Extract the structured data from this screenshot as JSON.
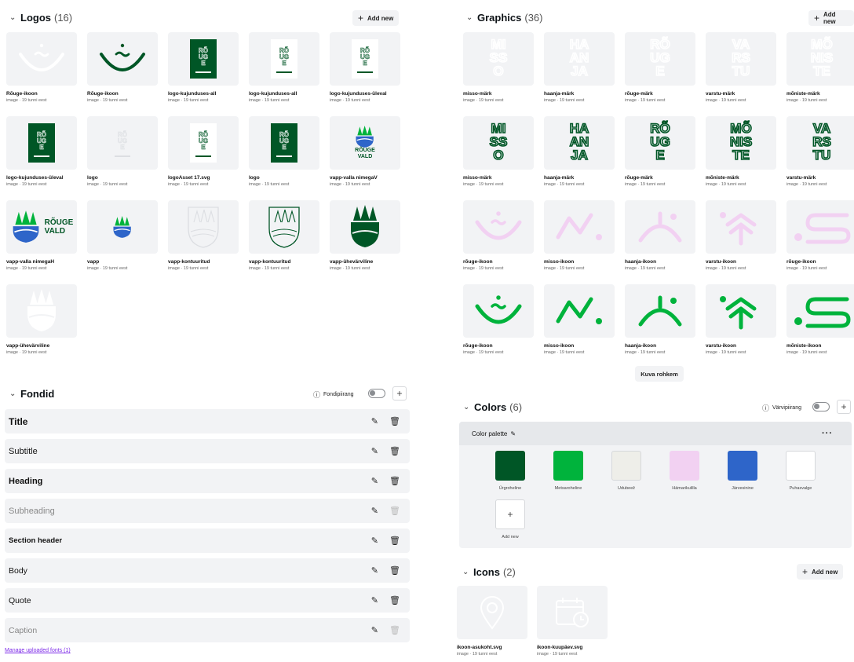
{
  "colors": {
    "dark_green": "#005626",
    "bright_green": "#00b33c",
    "pink": "#f2d1f2",
    "blue": "#2e65c9",
    "mist": "#eeeee9"
  },
  "logos": {
    "title": "Logos",
    "count": "(16)",
    "add_label": "Add new",
    "items": [
      {
        "name": "Rõuge-ikoon",
        "meta": "image · 19 tunni eest",
        "icon": "smile-symbol-white"
      },
      {
        "name": "Rõuge-ikoon",
        "meta": "image · 19 tunni eest",
        "icon": "smile-symbol-green"
      },
      {
        "name": "logo-kujunduses-all",
        "meta": "image · 19 tunni eest",
        "icon": "rouge-logo-green-box"
      },
      {
        "name": "logo-kujunduses-all",
        "meta": "image · 19 tunni eest",
        "icon": "rouge-logo-vald-white"
      },
      {
        "name": "logo-kujunduses-üleval",
        "meta": "image · 19 tunni eest",
        "icon": "rouge-logo-vald-white"
      },
      {
        "name": "logo-kujunduses-üleval",
        "meta": "image · 19 tunni eest",
        "icon": "rouge-logo-green-box"
      },
      {
        "name": "logo",
        "meta": "image · 19 tunni eest",
        "icon": "rouge-logo-faded"
      },
      {
        "name": "logoAsset 17.svg",
        "meta": "image · 19 tunni eest",
        "icon": "rouge-logo-vald-white"
      },
      {
        "name": "logo",
        "meta": "image · 19 tunni eest",
        "icon": "rouge-logo-green-box"
      },
      {
        "name": "vapp-valla nimegaV",
        "meta": "image · 19 tunni eest",
        "icon": "coat-of-arms-vertical"
      },
      {
        "name": "vapp-valla nimegaH",
        "meta": "image · 19 tunni eest",
        "icon": "coat-of-arms-horizontal"
      },
      {
        "name": "vapp",
        "meta": "image · 19 tunni eest",
        "icon": "coat-of-arms-small"
      },
      {
        "name": "vapp-kontuuritud",
        "meta": "image · 19 tunni eest",
        "icon": "coat-of-arms-outline-faded"
      },
      {
        "name": "vapp-kontuuritud",
        "meta": "image · 19 tunni eest",
        "icon": "coat-of-arms-outline"
      },
      {
        "name": "vapp-ühevärviline",
        "meta": "image · 19 tunni eest",
        "icon": "coat-of-arms-mono"
      },
      {
        "name": "vapp-ühevärviline",
        "meta": "image · 19 tunni eest",
        "icon": "coat-of-arms-white"
      }
    ]
  },
  "graphics": {
    "title": "Graphics",
    "count": "(36)",
    "add_label": "Add new",
    "more_label": "Kuva rohkem",
    "items": [
      {
        "name": "misso-märk",
        "meta": "image · 19 tunni eest"
      },
      {
        "name": "haanja-märk",
        "meta": "image · 19 tunni eest"
      },
      {
        "name": "rõuge-märk",
        "meta": "image · 19 tunni eest"
      },
      {
        "name": "varstu-märk",
        "meta": "image · 19 tunni eest"
      },
      {
        "name": "mõniste-märk",
        "meta": "image · 19 tunni eest"
      },
      {
        "name": "misso-märk",
        "meta": "image · 19 tunni eest"
      },
      {
        "name": "haanja-märk",
        "meta": "image · 19 tunni eest"
      },
      {
        "name": "rõuge-märk",
        "meta": "image · 19 tunni eest"
      },
      {
        "name": "mõniste-märk",
        "meta": "image · 19 tunni eest"
      },
      {
        "name": "varstu-märk",
        "meta": "image · 19 tunni eest"
      },
      {
        "name": "rõuge-ikoon",
        "meta": "image · 19 tunni eest"
      },
      {
        "name": "misso-ikoon",
        "meta": "image · 19 tunni eest"
      },
      {
        "name": "haanja-ikoon",
        "meta": "image · 19 tunni eest"
      },
      {
        "name": "varstu-ikoon",
        "meta": "image · 19 tunni eest"
      },
      {
        "name": "rõuge-ikoon",
        "meta": "image · 19 tunni eest"
      },
      {
        "name": "rõuge-ikoon",
        "meta": "image · 19 tunni eest"
      },
      {
        "name": "misso-ikoon",
        "meta": "image · 19 tunni eest"
      },
      {
        "name": "haanja-ikoon",
        "meta": "image · 19 tunni eest"
      },
      {
        "name": "varstu-ikoon",
        "meta": "image · 19 tunni eest"
      },
      {
        "name": "mõniste-ikoon",
        "meta": "image · 19 tunni eest"
      }
    ],
    "marks": {
      "misso": [
        "MI",
        "SS",
        "O"
      ],
      "haanja": [
        "HA",
        "AN",
        "JA"
      ],
      "rouge": [
        "RÕ",
        "UG",
        "E"
      ],
      "varstu": [
        "VA",
        "RS",
        "TU"
      ],
      "moniste": [
        "MÕ",
        "NIS",
        "TE"
      ]
    }
  },
  "fonts": {
    "title": "Fondid",
    "limit_label": "Fondipiirang",
    "manage_link": "Manage uploaded fonts (1)",
    "items": [
      {
        "name": "Title"
      },
      {
        "name": "Subtitle"
      },
      {
        "name": "Heading"
      },
      {
        "name": "Subheading"
      },
      {
        "name": "Section header"
      },
      {
        "name": "Body"
      },
      {
        "name": "Quote"
      },
      {
        "name": "Caption"
      }
    ]
  },
  "color_section": {
    "title": "Colors",
    "count": "(6)",
    "limit_label": "Värvipiirang",
    "palette_label": "Color palette",
    "add_label": "Add new",
    "swatches": [
      {
        "name": "Ürgroheline",
        "hex": "#005626"
      },
      {
        "name": "Metsaroheline",
        "hex": "#00b33c"
      },
      {
        "name": "Udubeež",
        "hex": "#eeeee9"
      },
      {
        "name": "Hämarikulilla",
        "hex": "#f2d1f2"
      },
      {
        "name": "Järvesinine",
        "hex": "#2e65c9"
      },
      {
        "name": "Puhasvalge",
        "hex": "#ffffff"
      }
    ]
  },
  "icons": {
    "title": "Icons",
    "count": "(2)",
    "add_label": "Add new",
    "items": [
      {
        "name": "ikoon-asukoht.svg",
        "meta": "image · 19 tunni eest",
        "icon": "location-pin-icon"
      },
      {
        "name": "ikoon-kuupäev.svg",
        "meta": "image · 19 tunni eest",
        "icon": "calendar-clock-icon"
      }
    ]
  }
}
